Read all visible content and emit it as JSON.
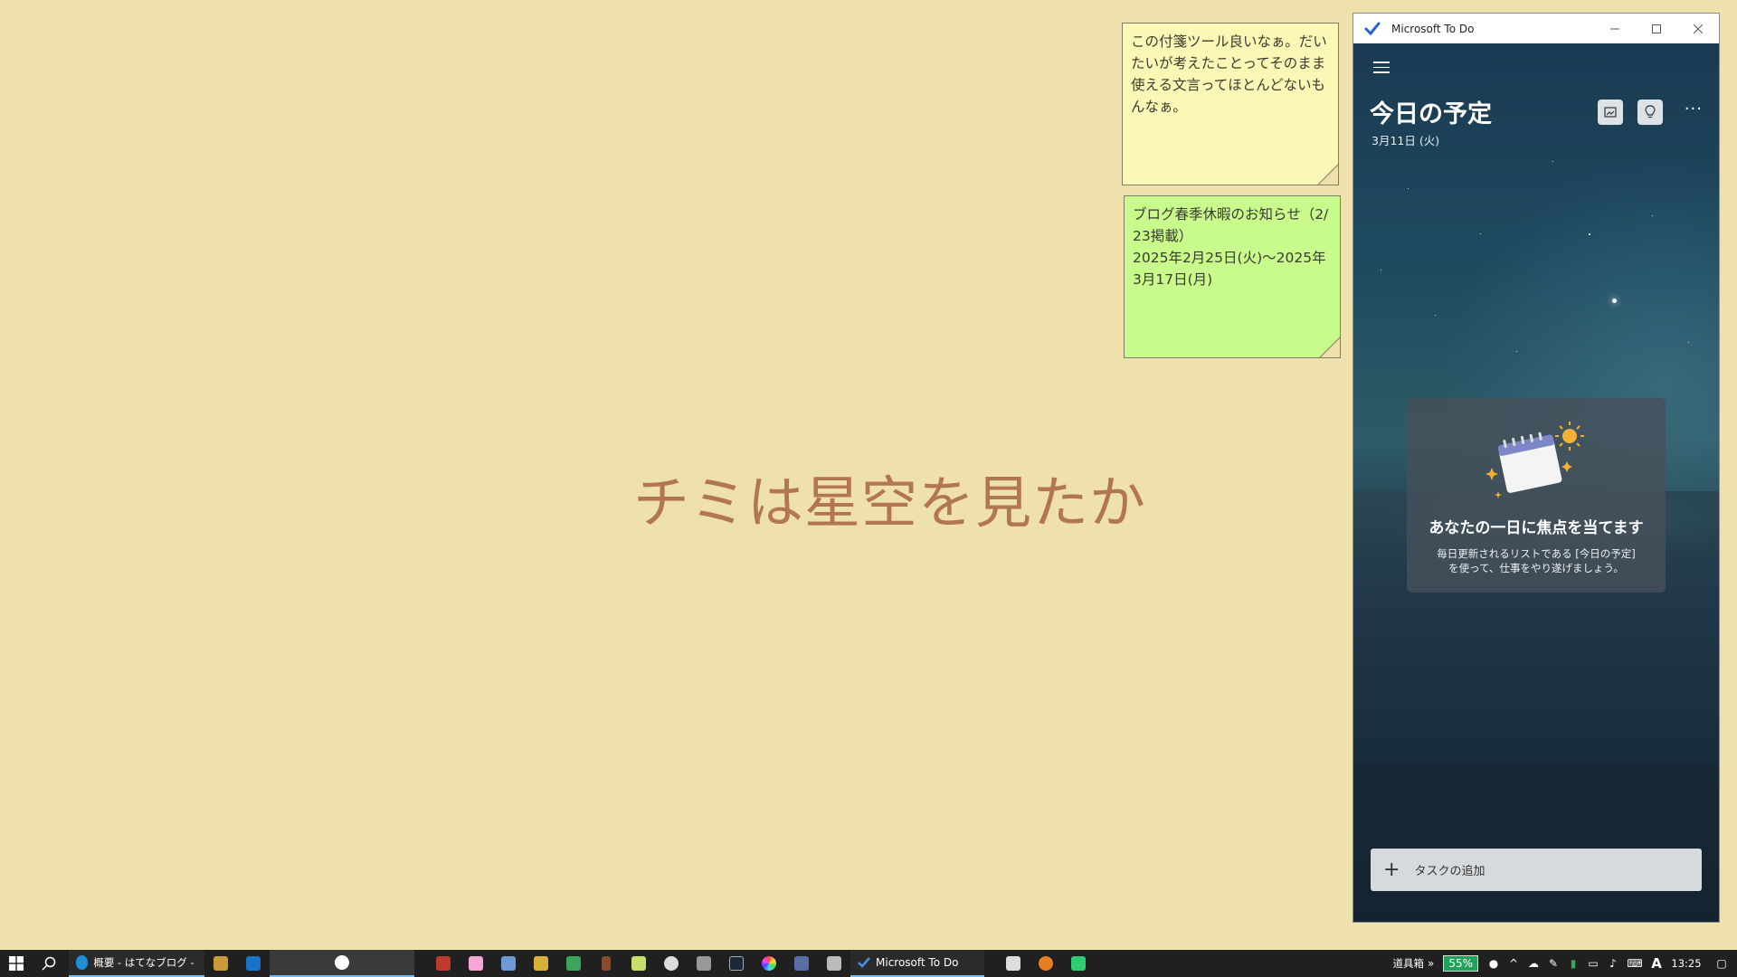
{
  "desktop": {
    "title": "チミは星空を見たか"
  },
  "sticky_notes": [
    {
      "text": "この付箋ツール良いなぁ。だいたいが考えたことってそのまま使える文言ってほとんどないもんなぁ。",
      "color": "#fbf8b6"
    },
    {
      "text": "ブログ春季休暇のお知らせ（2/23掲載）\n2025年2月25日(火)～2025年3月17日(月)",
      "color": "#c9fa8c"
    }
  ],
  "todo_window": {
    "window_title": "Microsoft To Do",
    "heading": "今日の予定",
    "date": "3月11日 (火)",
    "more_label": "···",
    "focus_card": {
      "title": "あなたの一日に焦点を当てます",
      "description_line1": "毎日更新されるリストである [今日の予定]",
      "description_line2": "を使って、仕事をやり遂げましょう。"
    },
    "add_task_label": "タスクの追加",
    "accent": "#2564cf"
  },
  "taskbar": {
    "browser_tab_label": "概要 - はてなブログ - 個...",
    "todo_label": "Microsoft To Do",
    "toolbar_label": "道具箱",
    "chevron_label": "»",
    "battery_percent": "55%",
    "ime_label": "A",
    "clock": "13:25"
  }
}
